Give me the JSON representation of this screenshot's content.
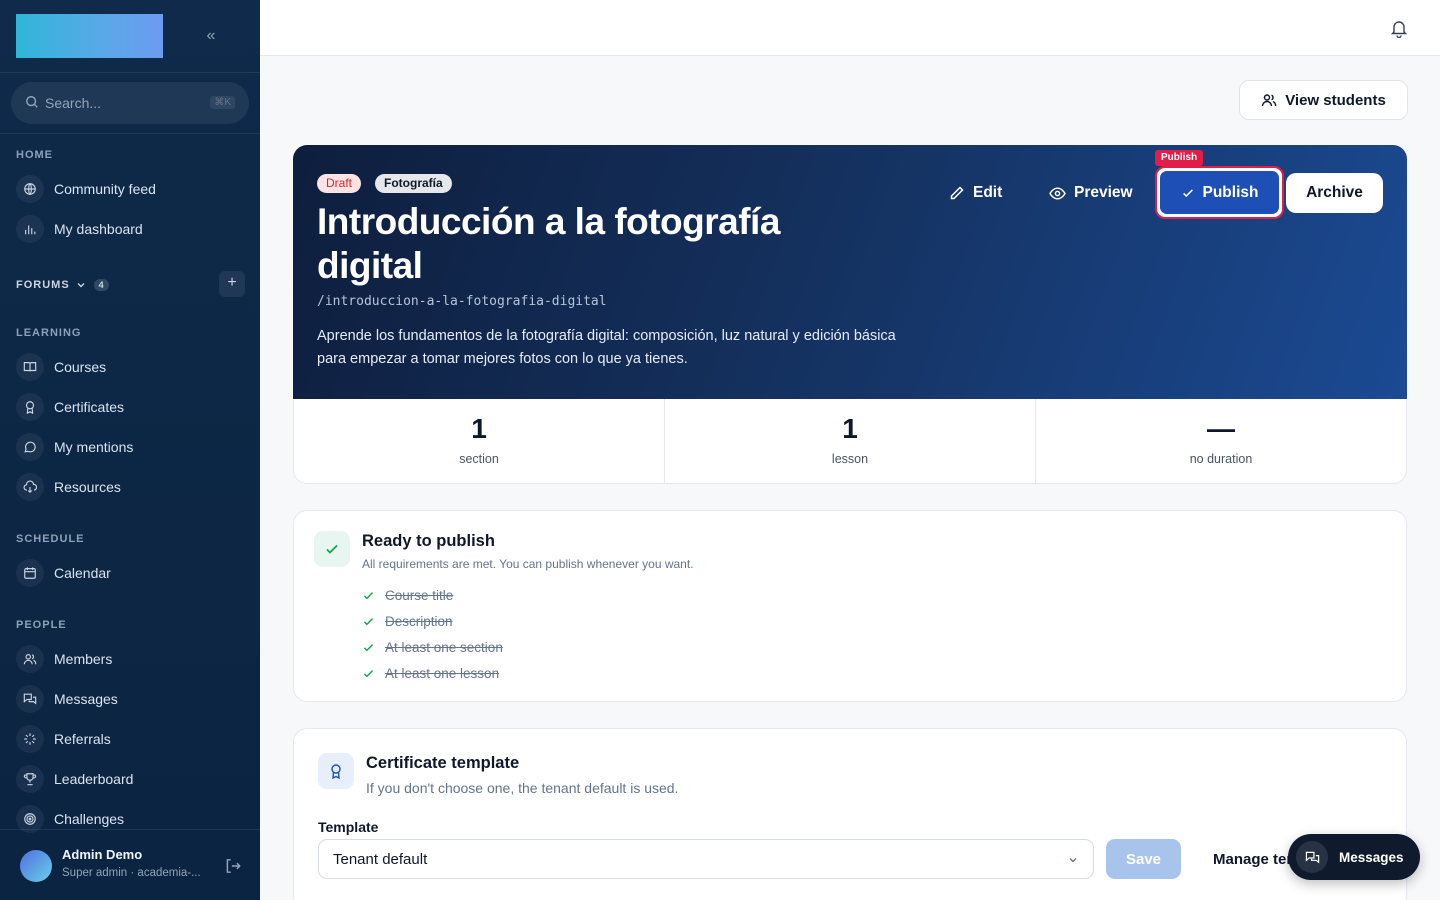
{
  "sidebar": {
    "search_placeholder": "Search...",
    "search_shortcut": "⌘K",
    "sections": {
      "home": "HOME",
      "forums": "FORUMS",
      "forums_count": "4",
      "learning": "LEARNING",
      "schedule": "SCHEDULE",
      "people": "PEOPLE"
    },
    "items": {
      "community_feed": "Community feed",
      "my_dashboard": "My dashboard",
      "courses": "Courses",
      "certificates": "Certificates",
      "my_mentions": "My mentions",
      "resources": "Resources",
      "calendar": "Calendar",
      "members": "Members",
      "messages": "Messages",
      "referrals": "Referrals",
      "leaderboard": "Leaderboard",
      "challenges": "Challenges"
    },
    "user": {
      "name": "Admin Demo",
      "role": "Super admin · academia-..."
    }
  },
  "header": {
    "view_students": "View students"
  },
  "course": {
    "status": "Draft",
    "category": "Fotografía",
    "title": "Introducción a la fotografía digital",
    "slug": "/introduccion-a-la-fotografia-digital",
    "description": "Aprende los fundamentos de la fotografía digital: composición, luz natural y edición básica para empezar a tomar mejores fotos con lo que ya tienes.",
    "actions": {
      "edit": "Edit",
      "preview": "Preview",
      "publish": "Publish",
      "publish_tag": "Publish",
      "archive": "Archive"
    },
    "stats": [
      {
        "value": "1",
        "label": "section"
      },
      {
        "value": "1",
        "label": "lesson"
      },
      {
        "value": "—",
        "label": "no duration"
      }
    ]
  },
  "ready": {
    "title": "Ready to publish",
    "subtitle": "All requirements are met. You can publish whenever you want.",
    "requirements": [
      "Course title",
      "Description",
      "At least one section",
      "At least one lesson"
    ]
  },
  "certificate": {
    "title": "Certificate template",
    "subtitle": "If you don't choose one, the tenant default is used.",
    "template_label": "Template",
    "template_value": "Tenant default",
    "save": "Save",
    "manage": "Manage templates"
  },
  "messages_fab": "Messages",
  "colors": {
    "sidebar_bg": "#0f2a4a",
    "accent_blue": "#1d4fb6",
    "publish_highlight": "#e11d48",
    "draft_red": "#dc2626",
    "success_green": "#16a34a"
  }
}
